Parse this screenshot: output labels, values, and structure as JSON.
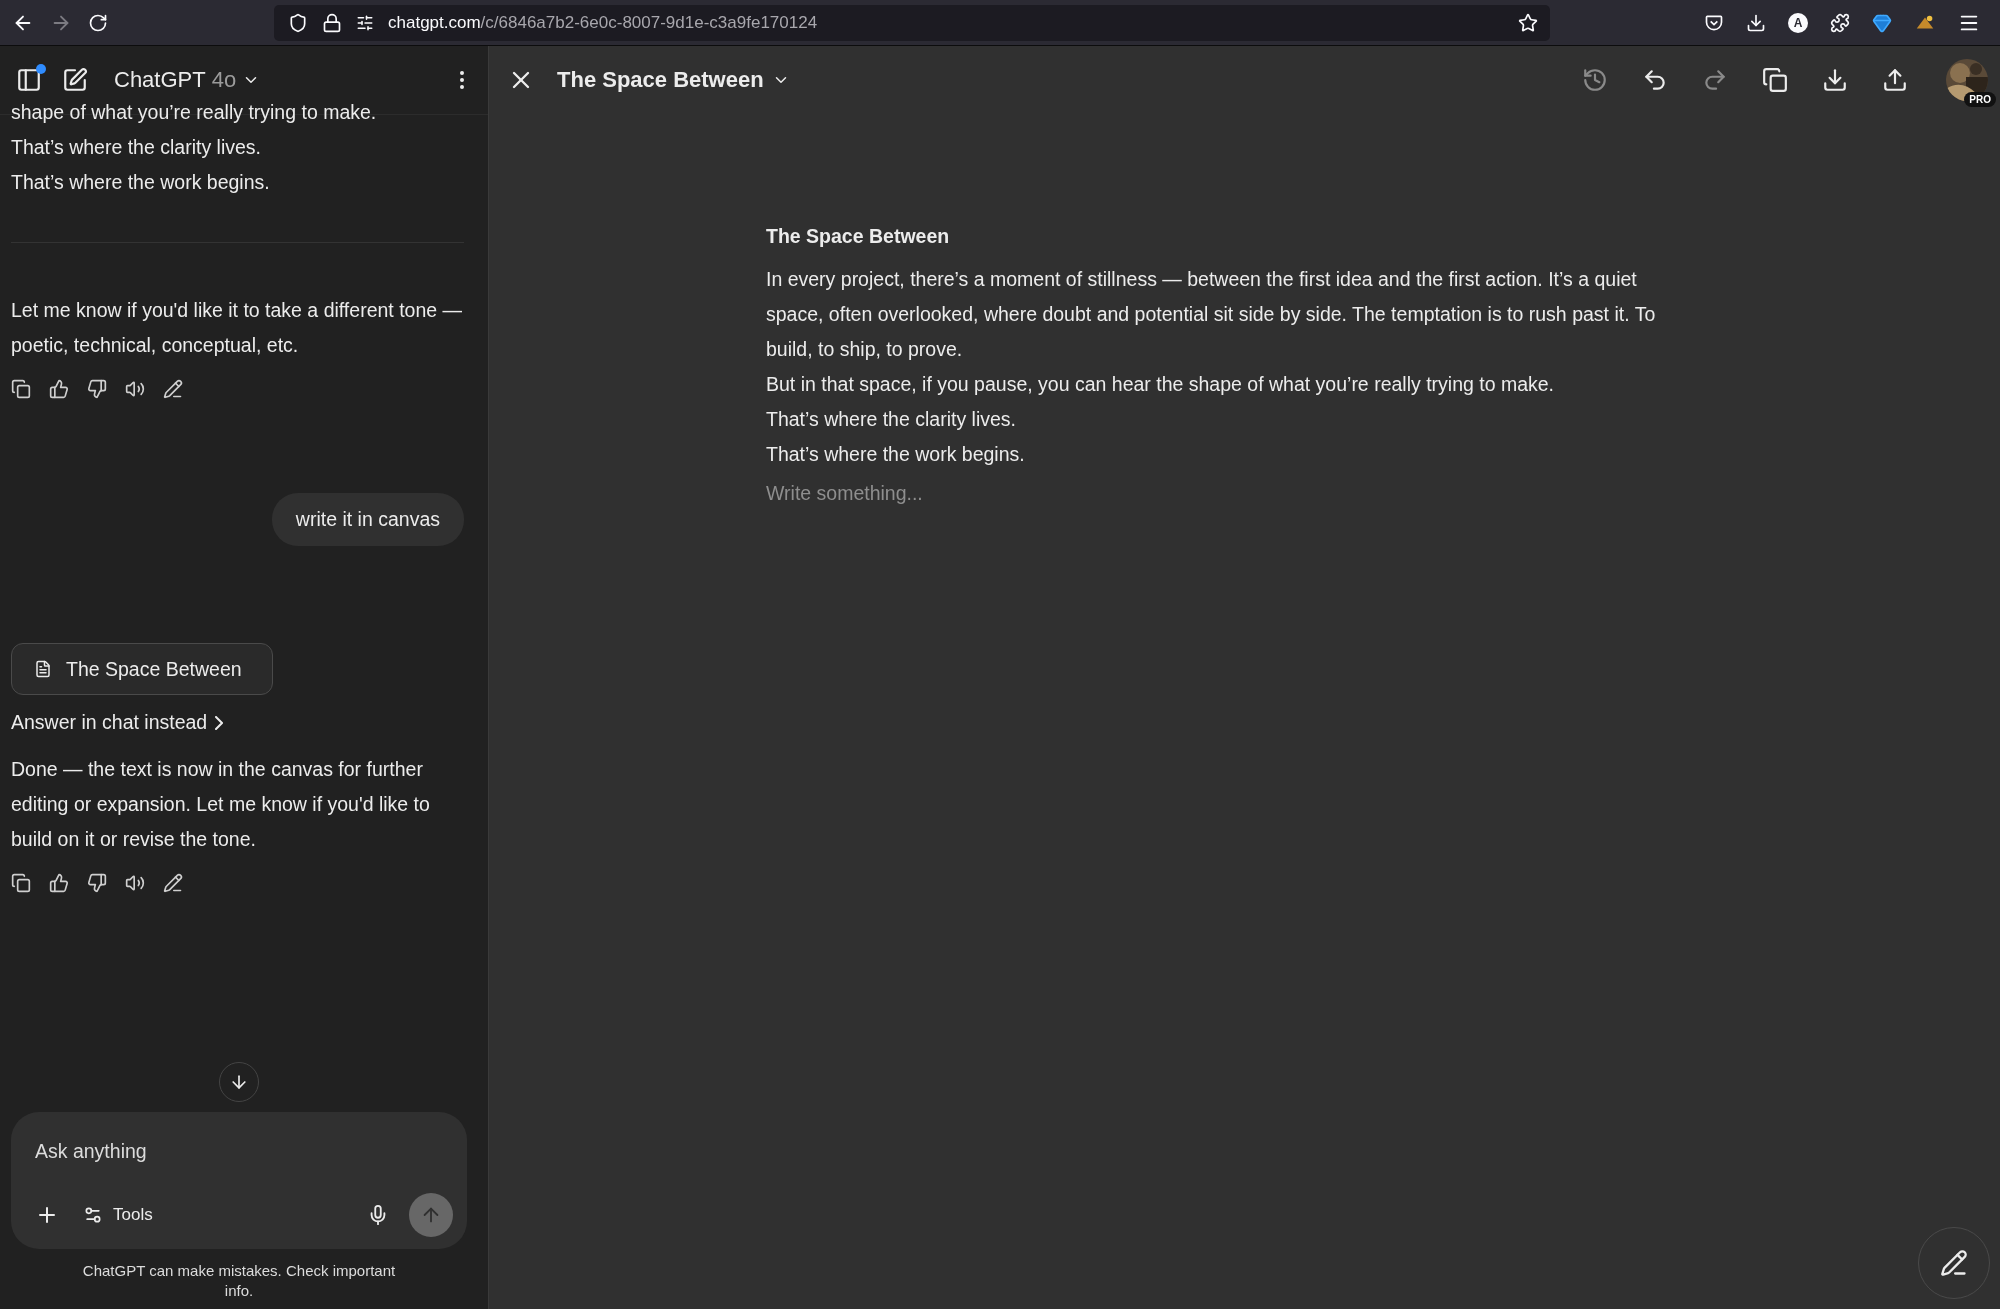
{
  "browser": {
    "url_host": "chatgpt.com",
    "url_path": "/c/6846a7b2-6e0c-8007-9d1e-c3a9fe170124",
    "account_initial": "A",
    "forward_disabled": true
  },
  "chat": {
    "model_name": "ChatGPT",
    "model_version": "4o",
    "messages": [
      {
        "kind": "text",
        "lines": [
          "shape of what you’re really trying to make.",
          "That’s where the clarity lives.",
          "That’s where the work begins."
        ],
        "actions": false
      },
      {
        "kind": "divider"
      },
      {
        "kind": "text",
        "lines": [
          "Let me know if you'd like it to take a different tone — poetic, technical, conceptual, etc."
        ],
        "actions": true
      },
      {
        "kind": "user",
        "text": "write it in canvas"
      },
      {
        "kind": "canvas_card",
        "text": "The Space Between"
      },
      {
        "kind": "link",
        "text": "Answer in chat instead"
      },
      {
        "kind": "text",
        "lines": [
          "Done — the text is now in the canvas for further editing or expansion. Let me know if you'd like to build on it or revise the tone."
        ],
        "actions": true
      }
    ],
    "composer": {
      "placeholder": "Ask anything",
      "tools_label": "Tools"
    },
    "disclaimer": "ChatGPT can make mistakes. Check important info."
  },
  "canvas": {
    "title": "The Space Between",
    "toolbar": [
      {
        "kind": "history",
        "disabled": true
      },
      {
        "kind": "undo",
        "disabled": false
      },
      {
        "kind": "redo",
        "disabled": true
      },
      {
        "kind": "copy",
        "disabled": false
      },
      {
        "kind": "download",
        "disabled": false
      },
      {
        "kind": "share",
        "disabled": false
      }
    ],
    "badge": "PRO",
    "document": {
      "title": "The Space Between",
      "paragraphs": [
        "In every project, there’s a moment of stillness — between the first idea and the first action. It’s a quiet space, often overlooked, where doubt and potential sit side by side. The temptation is to rush past it. To build, to ship, to prove.",
        "But in that space, if you pause, you can hear the shape of what you’re really trying to make.",
        "That’s where the clarity lives.",
        "That’s where the work begins."
      ],
      "placeholder": "Write something..."
    }
  }
}
